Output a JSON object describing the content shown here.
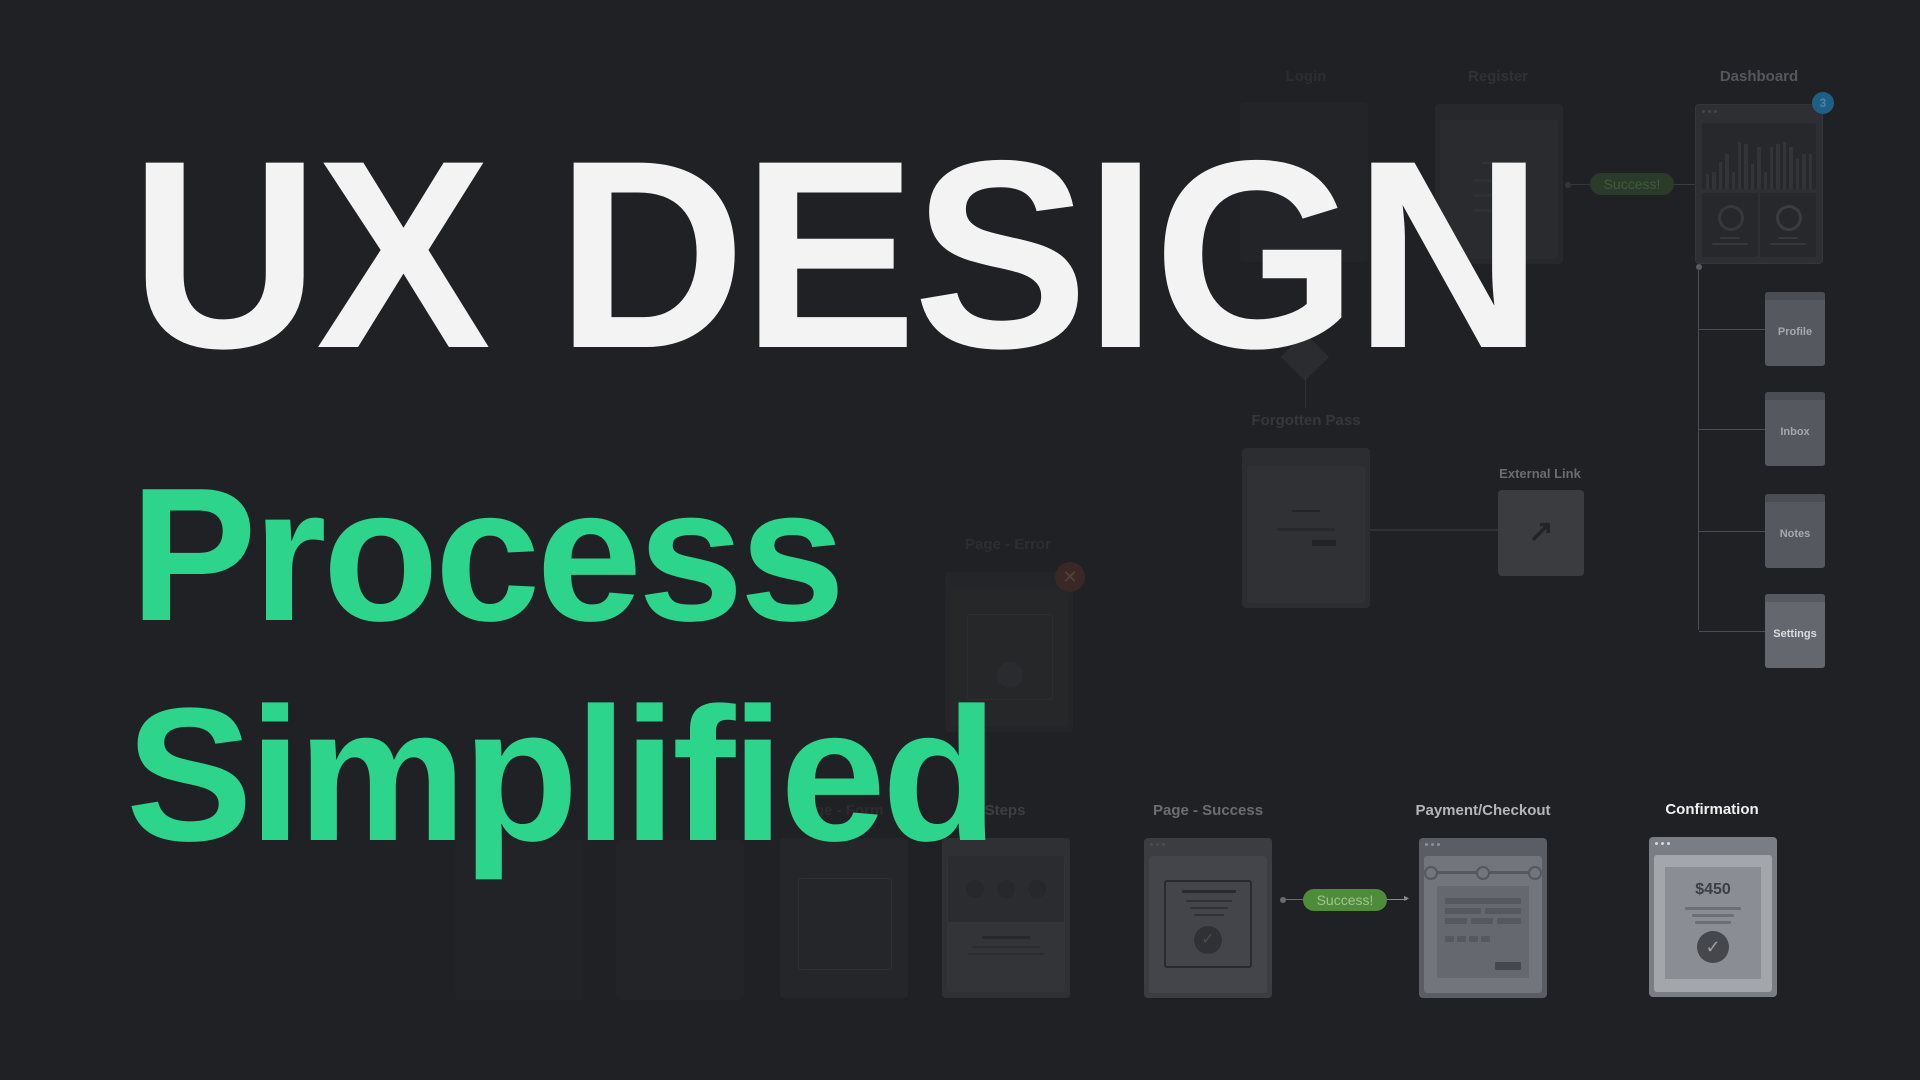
{
  "hero": {
    "title": "UX DESIGN",
    "subtitle_line1": "Process",
    "subtitle_line2": "Simplified"
  },
  "colors": {
    "background": "#202124",
    "title": "#f3f3f3",
    "accent": "#2dd48c",
    "success_pill": "#4e8c3a",
    "badge": "#1f5f86",
    "error_badge": "#6b2e2a"
  },
  "flow": {
    "top_row": {
      "login_label": "Login",
      "register_label": "Register",
      "success_pill": "Success!",
      "dashboard_label": "Dashboard",
      "dashboard_badge": "3"
    },
    "branches": [
      "Profile",
      "Inbox",
      "Notes",
      "Settings"
    ],
    "forgotten_label": "Forgotten Pass",
    "external_label": "External Link",
    "external_icon": "arrow-up-right-icon",
    "error_label": "Page - Error",
    "bottom_row": {
      "form_label": "Page - Form",
      "steps_label": "Steps",
      "success_page_label": "Page - Success",
      "success_pill": "Success!",
      "payment_label": "Payment/Checkout",
      "confirmation_label": "Confirmation",
      "confirmation_amount": "$450"
    }
  }
}
